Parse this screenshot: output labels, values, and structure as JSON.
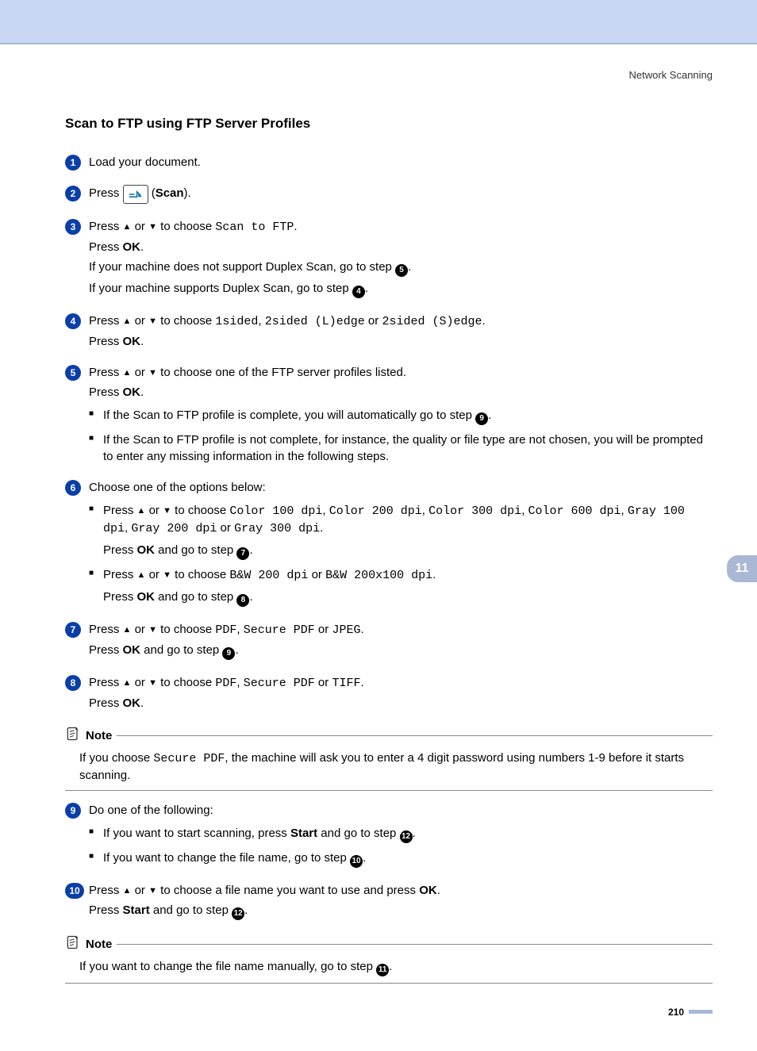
{
  "run_head": "Network Scanning",
  "section_title": "Scan to FTP using FTP Server Profiles",
  "chapter_tab": "11",
  "page_number": "210",
  "btn_scan_label": "Scan",
  "ok": "OK",
  "start": "Start",
  "steps": {
    "s1": {
      "num": "1",
      "text": "Load your document."
    },
    "s2": {
      "num": "2",
      "a": "Press ",
      "c": "(",
      "d": ")."
    },
    "s3": {
      "num": "3",
      "a": "Press ",
      "b": " or ",
      "c": " to choose ",
      "opt": "Scan to FTP",
      "d": ".",
      "e": "Press ",
      "f": ".",
      "g1": "If your machine does not support Duplex Scan, go to step ",
      "g1n": "5",
      "g1d": ".",
      "h1": "If your machine supports Duplex Scan, go to step ",
      "h1n": "4",
      "h1d": "."
    },
    "s4": {
      "num": "4",
      "a": "Press ",
      "b": " or ",
      "c": " to choose ",
      "o1": "1sided",
      "sep1": ", ",
      "o2": "2sided (L)edge",
      "or": " or ",
      "o3": "2sided (S)edge",
      "d": ".",
      "e": "Press ",
      "f": "."
    },
    "s5": {
      "num": "5",
      "a": "Press ",
      "b": " or ",
      "c": " to choose one of the FTP server profiles listed.",
      "e": "Press ",
      "f": ".",
      "sub1a": "If the Scan to FTP profile is complete, you will automatically go to step ",
      "sub1n": "9",
      "sub1d": ".",
      "sub2": "If the Scan to FTP profile is not complete, for instance, the quality or file type are not chosen, you will be prompted to enter any missing information in the following steps."
    },
    "s6": {
      "num": "6",
      "lead": "Choose one of the options below:",
      "a": "Press ",
      "b": " or ",
      "c": " to choose ",
      "o1": "Color 100 dpi",
      "sep": ", ",
      "o2": "Color 200 dpi",
      "o3": "Color 300 dpi",
      "o4": "Color 600 dpi",
      "o5": "Gray 100 dpi",
      "o6": "Gray 200 dpi",
      "or": " or ",
      "o7": "Gray 300 dpi",
      "d": ".",
      "p1a": "Press ",
      "p1b": " and go to step ",
      "p1n": "7",
      "p1d": ".",
      "b2a": "Press ",
      "b2b": " or ",
      "b2c": " to choose ",
      "bo1": "B&W 200 dpi",
      "bor": " or ",
      "bo2": "B&W 200x100 dpi",
      "bd": ".",
      "p2a": "Press ",
      "p2b": " and go to step ",
      "p2n": "8",
      "p2d": "."
    },
    "s7": {
      "num": "7",
      "a": "Press ",
      "b": " or ",
      "c": " to choose ",
      "o1": "PDF",
      "sep": ", ",
      "o2": "Secure PDF",
      "or": " or ",
      "o3": "JPEG",
      "d": ".",
      "p1a": "Press ",
      "p1b": " and go to step ",
      "p1n": "9",
      "p1d": "."
    },
    "s8": {
      "num": "8",
      "a": "Press ",
      "b": " or ",
      "c": " to choose ",
      "o1": "PDF",
      "sep": ", ",
      "o2": "Secure PDF",
      "or": " or ",
      "o3": "TIFF",
      "d": ".",
      "e": "Press ",
      "f": "."
    },
    "s9": {
      "num": "9",
      "lead": "Do one of the following:",
      "sub1a": "If you want to start scanning, press ",
      "sub1b": " and go to step ",
      "sub1n": "12",
      "sub1d": ".",
      "sub2a": "If you want to change the file name, go to step ",
      "sub2n": "10",
      "sub2d": "."
    },
    "s10": {
      "num": "10",
      "a": "Press ",
      "b": " or ",
      "c": " to choose a file name you want to use and press ",
      "d": ".",
      "e": "Press ",
      "f": " and go to step ",
      "fn": "12",
      "fd": "."
    }
  },
  "notes": {
    "label": "Note",
    "n1a": "If you choose ",
    "n1opt": "Secure PDF",
    "n1b": ", the machine will ask you to enter a 4 digit password using numbers 1-9 before it starts scanning.",
    "n2a": "If you want to change the file name manually, go to step ",
    "n2n": "11",
    "n2d": "."
  }
}
